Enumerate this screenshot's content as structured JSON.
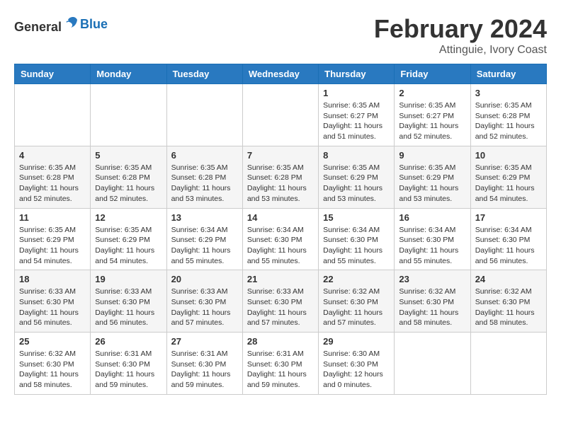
{
  "logo": {
    "text_general": "General",
    "text_blue": "Blue"
  },
  "title": {
    "month": "February 2024",
    "location": "Attinguie, Ivory Coast"
  },
  "headers": [
    "Sunday",
    "Monday",
    "Tuesday",
    "Wednesday",
    "Thursday",
    "Friday",
    "Saturday"
  ],
  "weeks": [
    [
      {
        "day": "",
        "detail": ""
      },
      {
        "day": "",
        "detail": ""
      },
      {
        "day": "",
        "detail": ""
      },
      {
        "day": "",
        "detail": ""
      },
      {
        "day": "1",
        "detail": "Sunrise: 6:35 AM\nSunset: 6:27 PM\nDaylight: 11 hours\nand 51 minutes."
      },
      {
        "day": "2",
        "detail": "Sunrise: 6:35 AM\nSunset: 6:27 PM\nDaylight: 11 hours\nand 52 minutes."
      },
      {
        "day": "3",
        "detail": "Sunrise: 6:35 AM\nSunset: 6:28 PM\nDaylight: 11 hours\nand 52 minutes."
      }
    ],
    [
      {
        "day": "4",
        "detail": "Sunrise: 6:35 AM\nSunset: 6:28 PM\nDaylight: 11 hours\nand 52 minutes."
      },
      {
        "day": "5",
        "detail": "Sunrise: 6:35 AM\nSunset: 6:28 PM\nDaylight: 11 hours\nand 52 minutes."
      },
      {
        "day": "6",
        "detail": "Sunrise: 6:35 AM\nSunset: 6:28 PM\nDaylight: 11 hours\nand 53 minutes."
      },
      {
        "day": "7",
        "detail": "Sunrise: 6:35 AM\nSunset: 6:28 PM\nDaylight: 11 hours\nand 53 minutes."
      },
      {
        "day": "8",
        "detail": "Sunrise: 6:35 AM\nSunset: 6:29 PM\nDaylight: 11 hours\nand 53 minutes."
      },
      {
        "day": "9",
        "detail": "Sunrise: 6:35 AM\nSunset: 6:29 PM\nDaylight: 11 hours\nand 53 minutes."
      },
      {
        "day": "10",
        "detail": "Sunrise: 6:35 AM\nSunset: 6:29 PM\nDaylight: 11 hours\nand 54 minutes."
      }
    ],
    [
      {
        "day": "11",
        "detail": "Sunrise: 6:35 AM\nSunset: 6:29 PM\nDaylight: 11 hours\nand 54 minutes."
      },
      {
        "day": "12",
        "detail": "Sunrise: 6:35 AM\nSunset: 6:29 PM\nDaylight: 11 hours\nand 54 minutes."
      },
      {
        "day": "13",
        "detail": "Sunrise: 6:34 AM\nSunset: 6:29 PM\nDaylight: 11 hours\nand 55 minutes."
      },
      {
        "day": "14",
        "detail": "Sunrise: 6:34 AM\nSunset: 6:30 PM\nDaylight: 11 hours\nand 55 minutes."
      },
      {
        "day": "15",
        "detail": "Sunrise: 6:34 AM\nSunset: 6:30 PM\nDaylight: 11 hours\nand 55 minutes."
      },
      {
        "day": "16",
        "detail": "Sunrise: 6:34 AM\nSunset: 6:30 PM\nDaylight: 11 hours\nand 55 minutes."
      },
      {
        "day": "17",
        "detail": "Sunrise: 6:34 AM\nSunset: 6:30 PM\nDaylight: 11 hours\nand 56 minutes."
      }
    ],
    [
      {
        "day": "18",
        "detail": "Sunrise: 6:33 AM\nSunset: 6:30 PM\nDaylight: 11 hours\nand 56 minutes."
      },
      {
        "day": "19",
        "detail": "Sunrise: 6:33 AM\nSunset: 6:30 PM\nDaylight: 11 hours\nand 56 minutes."
      },
      {
        "day": "20",
        "detail": "Sunrise: 6:33 AM\nSunset: 6:30 PM\nDaylight: 11 hours\nand 57 minutes."
      },
      {
        "day": "21",
        "detail": "Sunrise: 6:33 AM\nSunset: 6:30 PM\nDaylight: 11 hours\nand 57 minutes."
      },
      {
        "day": "22",
        "detail": "Sunrise: 6:32 AM\nSunset: 6:30 PM\nDaylight: 11 hours\nand 57 minutes."
      },
      {
        "day": "23",
        "detail": "Sunrise: 6:32 AM\nSunset: 6:30 PM\nDaylight: 11 hours\nand 58 minutes."
      },
      {
        "day": "24",
        "detail": "Sunrise: 6:32 AM\nSunset: 6:30 PM\nDaylight: 11 hours\nand 58 minutes."
      }
    ],
    [
      {
        "day": "25",
        "detail": "Sunrise: 6:32 AM\nSunset: 6:30 PM\nDaylight: 11 hours\nand 58 minutes."
      },
      {
        "day": "26",
        "detail": "Sunrise: 6:31 AM\nSunset: 6:30 PM\nDaylight: 11 hours\nand 59 minutes."
      },
      {
        "day": "27",
        "detail": "Sunrise: 6:31 AM\nSunset: 6:30 PM\nDaylight: 11 hours\nand 59 minutes."
      },
      {
        "day": "28",
        "detail": "Sunrise: 6:31 AM\nSunset: 6:30 PM\nDaylight: 11 hours\nand 59 minutes."
      },
      {
        "day": "29",
        "detail": "Sunrise: 6:30 AM\nSunset: 6:30 PM\nDaylight: 12 hours\nand 0 minutes."
      },
      {
        "day": "",
        "detail": ""
      },
      {
        "day": "",
        "detail": ""
      }
    ]
  ]
}
